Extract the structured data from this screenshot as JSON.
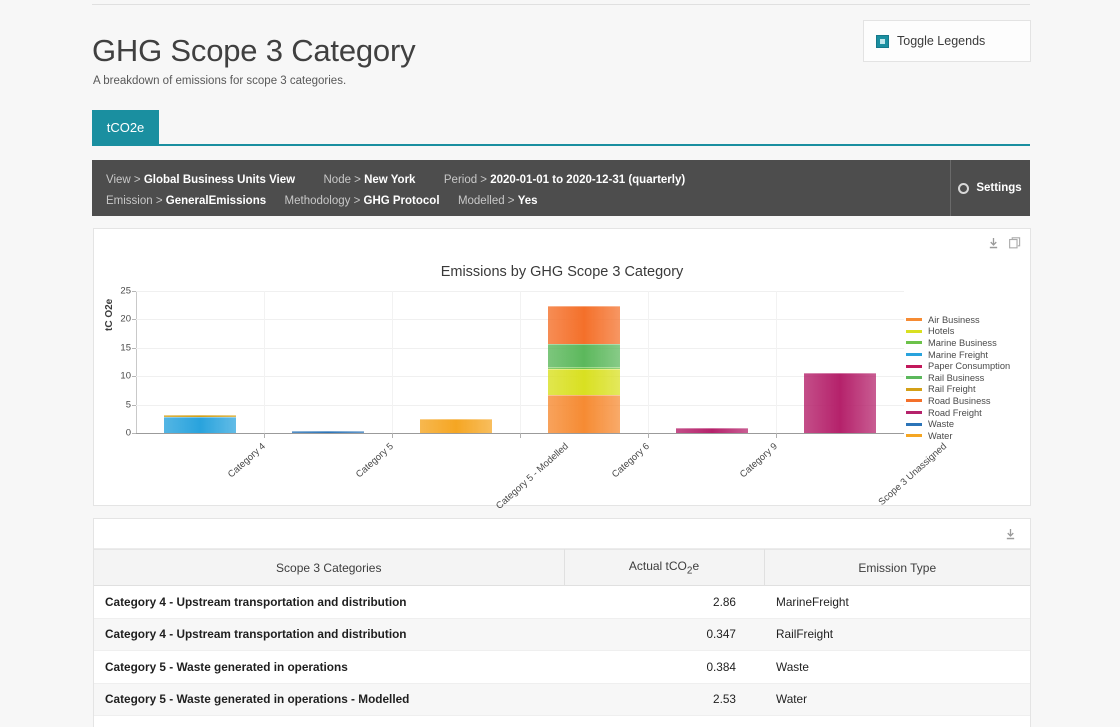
{
  "header": {
    "title": "GHG Scope 3 Category",
    "subtitle": "A breakdown of emissions for scope 3 categories.",
    "toggle_legends_label": "Toggle Legends"
  },
  "tabs": [
    {
      "label": "tCO2e",
      "active": true
    }
  ],
  "filters": {
    "rows": [
      [
        {
          "label": "View >",
          "value": "Global Business Units View"
        },
        {
          "label": "Node >",
          "value": "New York"
        },
        {
          "label": "Period >",
          "value": "2020-01-01 to 2020-12-31 (quarterly)"
        }
      ],
      [
        {
          "label": "Emission >",
          "value": "GeneralEmissions"
        },
        {
          "label": "Methodology >",
          "value": "GHG Protocol"
        },
        {
          "label": "Modelled >",
          "value": "Yes"
        }
      ]
    ],
    "settings_label": "Settings"
  },
  "chart_panel": {
    "download_icon": "download-icon",
    "copy_icon": "copy-icon"
  },
  "chart_data": {
    "type": "bar",
    "stacked": true,
    "title": "Emissions by GHG Scope 3 Category",
    "xlabel": "",
    "ylabel": "tC O2e",
    "ylim": [
      0,
      25
    ],
    "yticks": [
      0,
      5,
      10,
      15,
      20,
      25
    ],
    "grid": true,
    "legend_position": "right",
    "categories": [
      "Category 4",
      "Category 5",
      "Category 5 - Modelled",
      "Category 6",
      "Category 9",
      "Scope 3 Unassigned"
    ],
    "series": [
      {
        "name": "Air Business",
        "color": "#f68b33",
        "values": [
          0,
          0,
          0,
          6.7,
          0,
          0
        ]
      },
      {
        "name": "Hotels",
        "color": "#d9e021",
        "values": [
          0,
          0,
          0,
          4.6,
          0,
          0
        ]
      },
      {
        "name": "Marine Business",
        "color": "#6cc24a",
        "values": [
          0,
          0,
          0,
          0.4,
          0,
          0
        ]
      },
      {
        "name": "Marine Freight",
        "color": "#29a3dd",
        "values": [
          2.86,
          0,
          0,
          0,
          0,
          0
        ]
      },
      {
        "name": "Paper Consumption",
        "color": "#c2185b",
        "values": [
          0,
          0,
          0,
          0,
          0,
          0
        ]
      },
      {
        "name": "Rail Business",
        "color": "#5cb85c",
        "values": [
          0,
          0,
          0,
          3.9,
          0,
          0
        ]
      },
      {
        "name": "Rail Freight",
        "color": "#d4a017",
        "values": [
          0.347,
          0,
          0,
          0,
          0,
          0
        ]
      },
      {
        "name": "Road Business",
        "color": "#f4702a",
        "values": [
          0,
          0,
          0,
          6.7,
          0,
          0
        ]
      },
      {
        "name": "Road Freight",
        "color": "#b5226b",
        "values": [
          0,
          0,
          0,
          0,
          0.9,
          10.5
        ]
      },
      {
        "name": "Waste",
        "color": "#2b74b8",
        "values": [
          0,
          0.384,
          0,
          0,
          0,
          0
        ]
      },
      {
        "name": "Water",
        "color": "#f5a623",
        "values": [
          0,
          0,
          2.53,
          0,
          0,
          0
        ]
      }
    ]
  },
  "table": {
    "download_icon": "download-icon",
    "columns": [
      "Scope 3 Categories",
      "Actual tCO2e",
      "Emission Type"
    ],
    "rows": [
      {
        "category": "Category 4 - Upstream transportation and distribution",
        "value": "2.86",
        "emission_type": "MarineFreight"
      },
      {
        "category": "Category 4 - Upstream transportation and distribution",
        "value": "0.347",
        "emission_type": "RailFreight"
      },
      {
        "category": "Category 5 - Waste generated in operations",
        "value": "0.384",
        "emission_type": "Waste"
      },
      {
        "category": "Category 5 - Waste generated in operations - Modelled",
        "value": "2.53",
        "emission_type": "Water"
      }
    ]
  }
}
